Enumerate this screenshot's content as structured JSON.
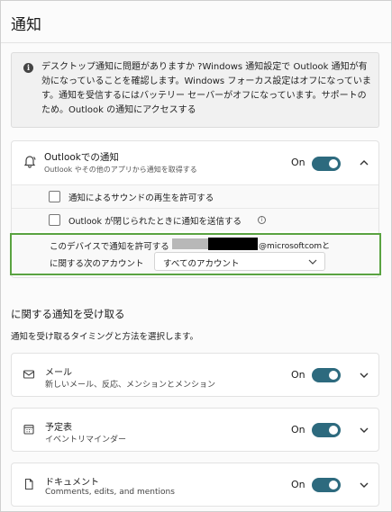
{
  "page": {
    "title": "通知"
  },
  "info": {
    "icon": "info-icon",
    "text": "デスクトップ通知に問題がありますか ?Windows 通知設定で Outlook 通知が有効になっていることを確認します。Windows フォーカス設定はオフになっています。通知を受信するにはバッテリー セーバーがオフになっています。サポートのため。Outlook の通知にアクセスする"
  },
  "outlook": {
    "title": "Outlookでの通知",
    "subtitle": "Outlook やその他のアプリから通知を取得する",
    "toggle_label": "On",
    "toggle_on": true,
    "icon": "notification-bell-icon",
    "options": [
      {
        "label": "通知によるサウンドの再生を許可する",
        "checked": false
      },
      {
        "label": "Outlook が閉じられたときに通知を送信する",
        "checked": false
      }
    ],
    "device": {
      "label": "このデバイスで通知を許可する",
      "email_domain": "@microsoftcomと",
      "account_label": "に関する次のアカウント",
      "select_value": "すべてのアカウント"
    }
  },
  "receive": {
    "heading": "に関する通知を受け取る",
    "subheading": "通知を受け取るタイミングと方法を選択します。"
  },
  "categories": [
    {
      "title": "メール",
      "subtitle": "新しいメール、反応、メンションとメンション",
      "toggle_label": "On",
      "icon": "mail-icon"
    },
    {
      "title": "予定表",
      "subtitle": "イベントリマインダー",
      "toggle_label": "On",
      "icon": "calendar-icon"
    },
    {
      "title": "ドキュメント",
      "subtitle": "Comments, edits, and mentions",
      "toggle_label": "On",
      "icon": "document-icon"
    }
  ],
  "colors": {
    "toggle_on": "#2d6a7e",
    "highlight_border": "#5aa341"
  }
}
